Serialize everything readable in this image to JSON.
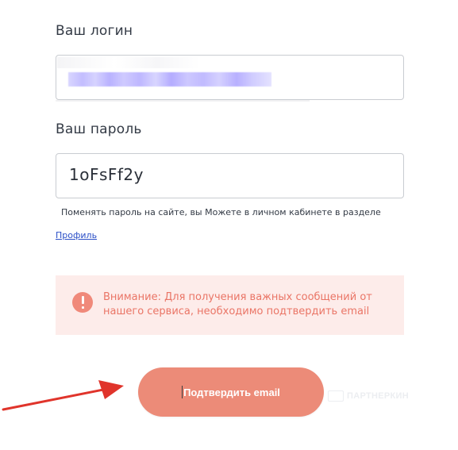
{
  "login": {
    "label": "Ваш логин"
  },
  "password": {
    "label": "Ваш пароль",
    "value": "1oFsFf2y",
    "hint": "Поменять пароль на сайте, вы Можете в личном кабинете в разделе",
    "profile_link": "Профиль"
  },
  "alert": {
    "icon": "exclamation-circle-icon",
    "text": "Внимание: Для получения важных сообщений от нашего сервиса, необходимо подтвердить email"
  },
  "confirm_button": {
    "label": "Подтвердить email"
  },
  "watermark": {
    "text": "ПАРТНЕРКИН"
  },
  "colors": {
    "accent": "#ec8b78",
    "alert_bg": "#fdecea",
    "alert_text": "#ea7566",
    "link": "#2b4fc7",
    "annotation_arrow": "#e0342b"
  }
}
